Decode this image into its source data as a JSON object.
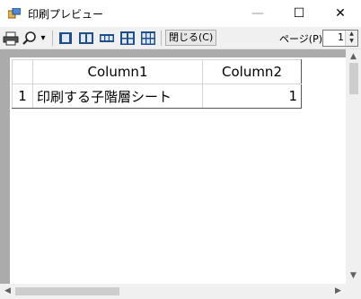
{
  "window": {
    "title": "印刷プレビュー",
    "minimize_glyph": "—",
    "maximize_glyph": "☐",
    "close_glyph": "✕"
  },
  "toolbar": {
    "icons": [
      "printer-icon",
      "zoom-icon",
      "one-page-icon",
      "two-pages-icon",
      "three-pages-icon",
      "four-pages-icon",
      "six-pages-icon"
    ],
    "zoom_dropdown_glyph": "▾",
    "close_label": "閉じる(C)",
    "page_label": "ページ(P)",
    "page_value": "1"
  },
  "sheet": {
    "headers": [
      "",
      "Column1",
      "Column2"
    ],
    "rows": [
      [
        "1",
        "印刷する子階層シート",
        "1"
      ]
    ]
  },
  "colors": {
    "toolbar_bg": "#f0f0f0",
    "preview_bg": "#ababab",
    "icon_blue": "#1f4e8c"
  }
}
